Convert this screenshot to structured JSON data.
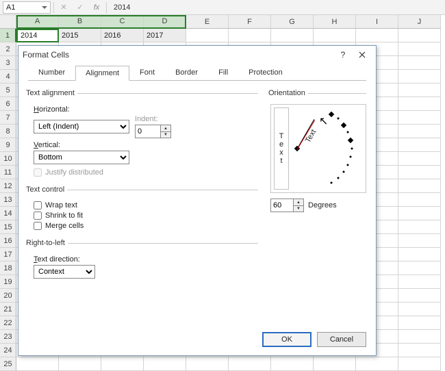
{
  "formula_bar": {
    "name_box": "A1",
    "fx_label": "fx",
    "value": "2014"
  },
  "columns": [
    "A",
    "B",
    "C",
    "D",
    "E",
    "F",
    "G",
    "H",
    "I",
    "J"
  ],
  "rows": [
    "1",
    "2",
    "3",
    "4",
    "5",
    "6",
    "7",
    "8",
    "9",
    "10",
    "11",
    "12",
    "13",
    "14",
    "15",
    "16",
    "17",
    "18",
    "19",
    "20",
    "21",
    "22",
    "23",
    "24",
    "25"
  ],
  "row1": [
    "2014",
    "2015",
    "2016",
    "2017",
    "",
    "",
    "",
    "",
    "",
    ""
  ],
  "dialog": {
    "title": "Format Cells",
    "tabs": [
      "Number",
      "Alignment",
      "Font",
      "Border",
      "Fill",
      "Protection"
    ],
    "active_tab": 1,
    "text_alignment": {
      "group": "Text alignment",
      "horizontal_label": "Horizontal:",
      "horizontal_value": "Left (Indent)",
      "indent_label": "Indent:",
      "indent_value": "0",
      "vertical_label": "Vertical:",
      "vertical_value": "Bottom",
      "justify_label": "Justify distributed"
    },
    "text_control": {
      "group": "Text control",
      "wrap": "Wrap text",
      "shrink": "Shrink to fit",
      "merge": "Merge cells"
    },
    "rtl": {
      "group": "Right-to-left",
      "dir_label": "Text direction:",
      "dir_value": "Context"
    },
    "orientation": {
      "group": "Orientation",
      "vtext": "Text",
      "degrees_value": "60",
      "degrees_label": "Degrees"
    },
    "buttons": {
      "ok": "OK",
      "cancel": "Cancel"
    },
    "help": "?"
  }
}
